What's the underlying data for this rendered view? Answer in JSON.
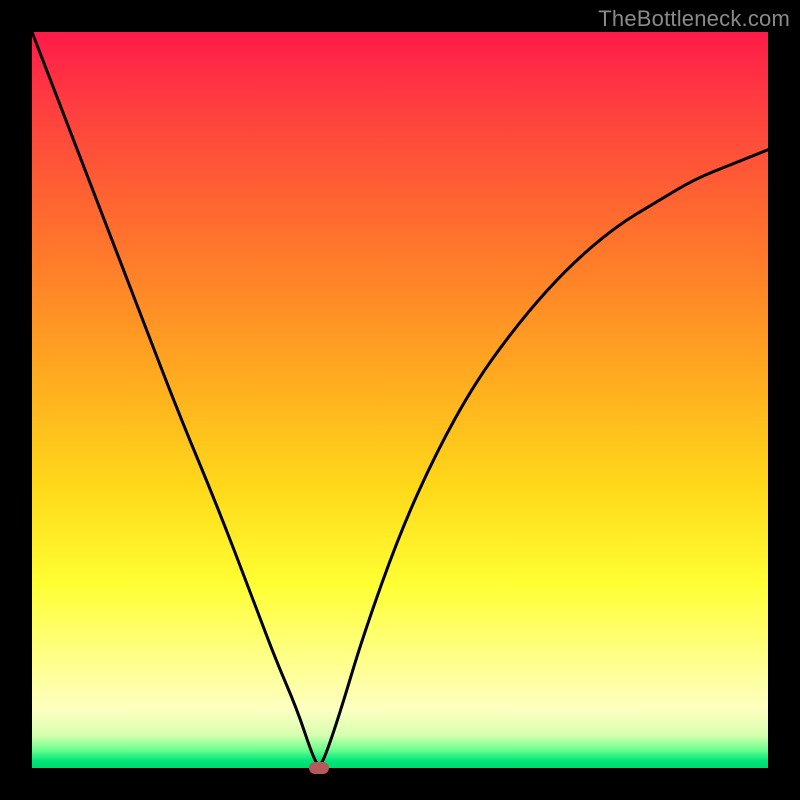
{
  "watermark": "TheBottleneck.com",
  "colors": {
    "frame": "#000000",
    "gradient_top": "#ff1a49",
    "gradient_mid": "#ffd91a",
    "gradient_bottom": "#00d96e",
    "curve": "#000000",
    "marker": "#b55a5a"
  },
  "chart_data": {
    "type": "line",
    "title": "",
    "xlabel": "",
    "ylabel": "",
    "xlim": [
      0,
      100
    ],
    "ylim": [
      0,
      100
    ],
    "grid": false,
    "legend": false,
    "annotations": [
      {
        "kind": "marker",
        "x": 39,
        "y": 0,
        "shape": "pill",
        "color": "#b55a5a"
      }
    ],
    "series": [
      {
        "name": "bottleneck-curve",
        "x": [
          0,
          5,
          10,
          15,
          20,
          25,
          30,
          33,
          36,
          38,
          39,
          40,
          42,
          45,
          50,
          55,
          60,
          65,
          70,
          75,
          80,
          85,
          90,
          95,
          100
        ],
        "y": [
          100,
          87,
          74,
          61,
          48,
          36,
          23,
          15,
          8,
          2,
          0,
          2,
          8,
          18,
          32,
          43,
          52,
          59,
          65,
          70,
          74,
          77,
          80,
          82,
          84
        ]
      }
    ]
  }
}
